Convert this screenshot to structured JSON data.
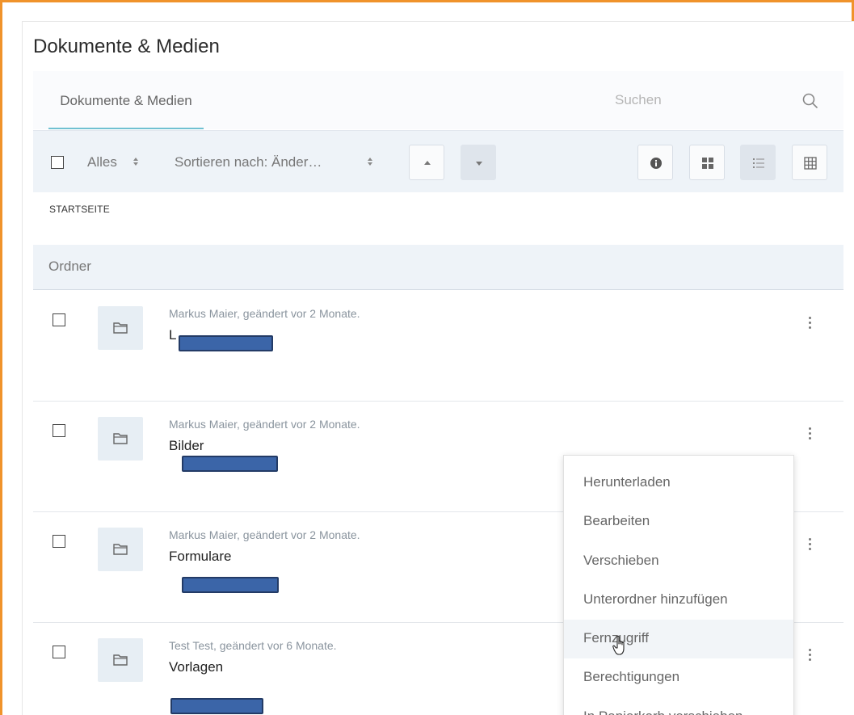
{
  "page": {
    "title": "Dokumente & Medien"
  },
  "tabs": {
    "active": "Dokumente & Medien",
    "search_placeholder": "Suchen"
  },
  "toolbar": {
    "select_label": "Alles",
    "sort_label": "Sortieren nach: Änder…"
  },
  "breadcrumb": "STARTSEITE",
  "section": {
    "title": "Ordner"
  },
  "rows": [
    {
      "meta": "Markus Maier, geändert vor 2 Monate.",
      "name": "L"
    },
    {
      "meta": "Markus Maier, geändert vor 2 Monate.",
      "name": "Bilder"
    },
    {
      "meta": "Markus Maier, geändert vor 2 Monate.",
      "name": "Formulare"
    },
    {
      "meta": "Test Test, geändert vor 6 Monate.",
      "name": "Vorlagen"
    }
  ],
  "menu": {
    "items": [
      "Herunterladen",
      "Bearbeiten",
      "Verschieben",
      "Unterordner hinzufügen",
      "Fernzugriff",
      "Berechtigungen",
      "In Papierkorb verschieben"
    ],
    "hovered": "Fernzugriff"
  },
  "colors": {
    "frame": "#f0932b",
    "accent": "#70c1d2",
    "redaction": "#3b65a8"
  }
}
